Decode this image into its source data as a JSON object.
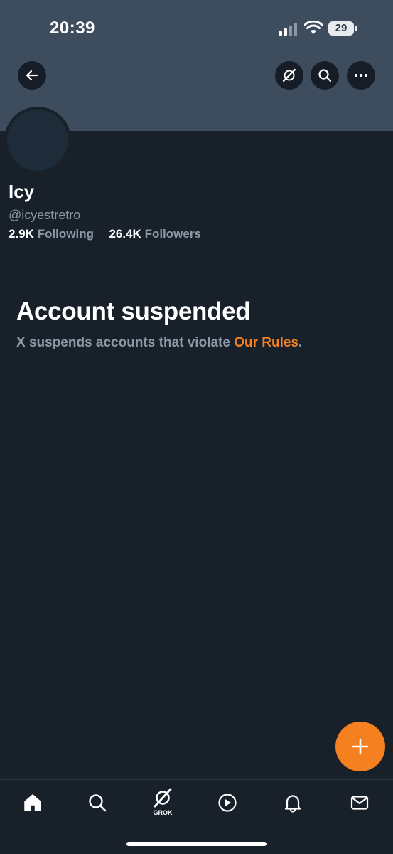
{
  "status_bar": {
    "time": "20:39",
    "battery_level": "29"
  },
  "header": {
    "back_icon": "arrow-left-icon",
    "actions": [
      "grok-icon",
      "search-icon",
      "more-icon"
    ]
  },
  "profile": {
    "display_name": "Icy",
    "handle": "@icyestretro",
    "following_count": "2.9K",
    "following_label": "Following",
    "followers_count": "26.4K",
    "followers_label": "Followers"
  },
  "suspension": {
    "title": "Account suspended",
    "message": "X suspends accounts that violate ",
    "link_text": "Our Rules",
    "trailing": "."
  },
  "tab_bar": {
    "grok_label": "GROK",
    "tabs": [
      "home-icon",
      "search-icon",
      "grok-icon",
      "video-icon",
      "notifications-icon",
      "messages-icon"
    ]
  },
  "colors": {
    "background": "#18202a",
    "banner": "#3e4d5e",
    "accent": "#f4801f",
    "secondary_text": "#8b98a5"
  }
}
